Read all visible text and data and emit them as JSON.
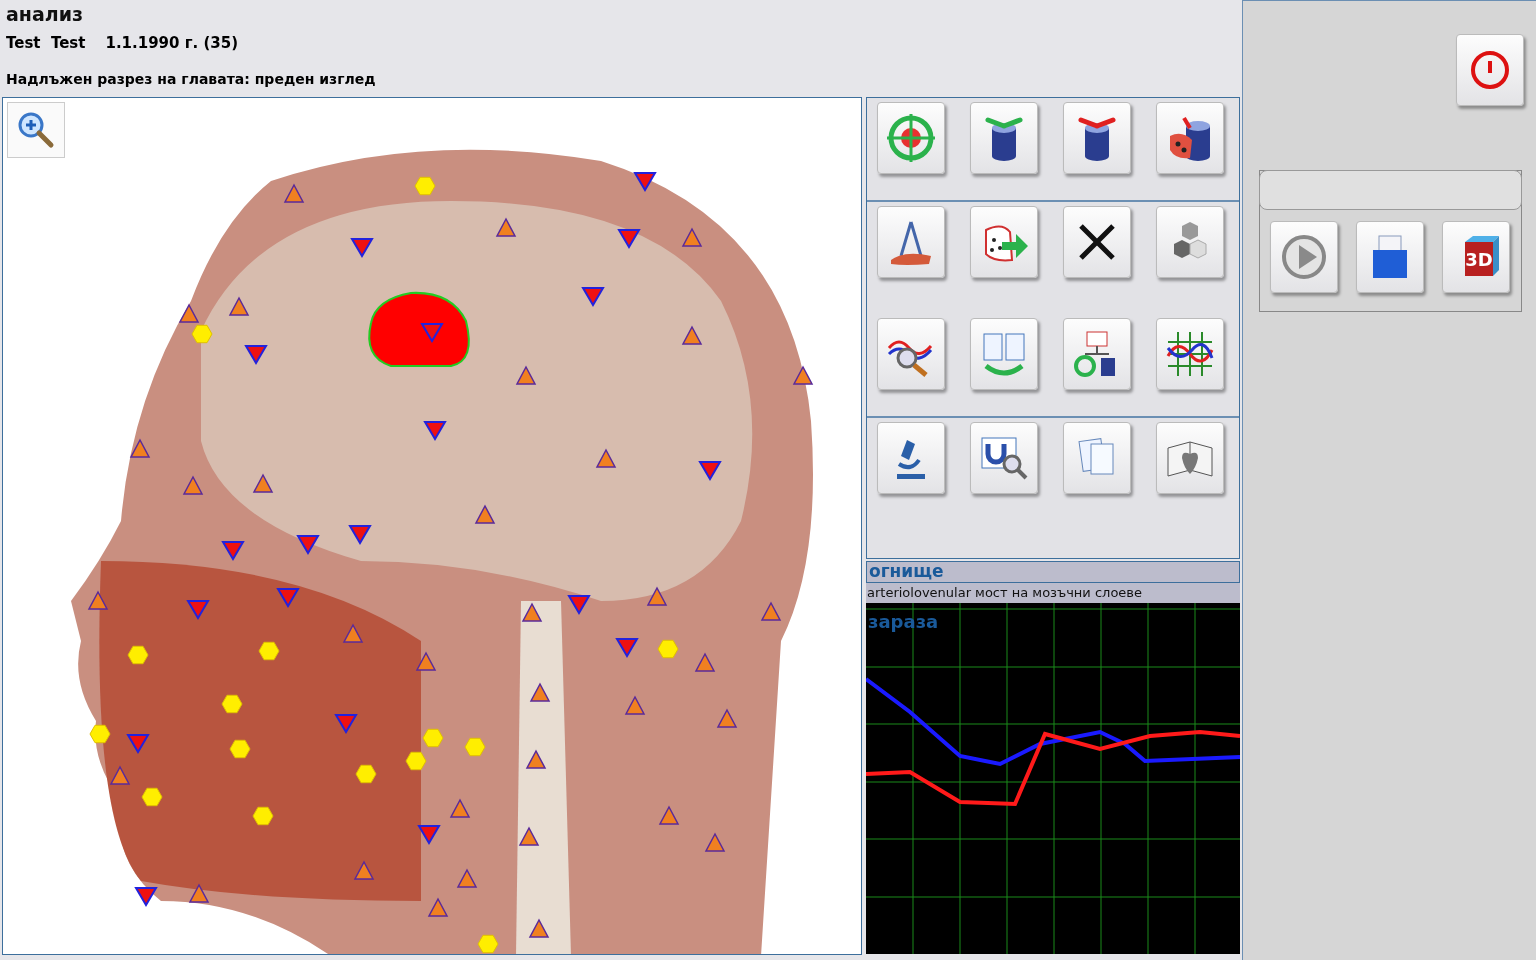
{
  "title": "анализ",
  "patient": {
    "name": "Test  Test",
    "birth": "1.1.1990 г. (35)"
  },
  "view_title": "Надлъжен разрез на главата: преден изглед",
  "toolbar": {
    "sections": [
      {
        "buttons": [
          {
            "kind": "target"
          },
          {
            "kind": "cylinder-green"
          },
          {
            "kind": "cylinder-red"
          },
          {
            "kind": "cylinder-dots"
          }
        ]
      },
      {
        "buttons": [
          {
            "kind": "compass"
          },
          {
            "kind": "map-arrow"
          },
          {
            "kind": "close"
          },
          {
            "kind": "hexagons"
          },
          {
            "kind": "wave-magnifier"
          },
          {
            "kind": "documents-cycle"
          },
          {
            "kind": "diagram"
          },
          {
            "kind": "wave-grid"
          }
        ]
      },
      {
        "buttons": [
          {
            "kind": "microscope"
          },
          {
            "kind": "magnet-magnifier"
          },
          {
            "kind": "documents"
          },
          {
            "kind": "book-heart"
          }
        ]
      }
    ]
  },
  "info": {
    "title": "огнище",
    "description": "arteriolovenular мост на мозъчни слоеве",
    "overlay_label": "зараза"
  },
  "side": {
    "group_buttons": [
      {
        "kind": "play"
      },
      {
        "kind": "folder"
      },
      {
        "kind": "cube-3d",
        "label": "3D"
      }
    ]
  }
}
